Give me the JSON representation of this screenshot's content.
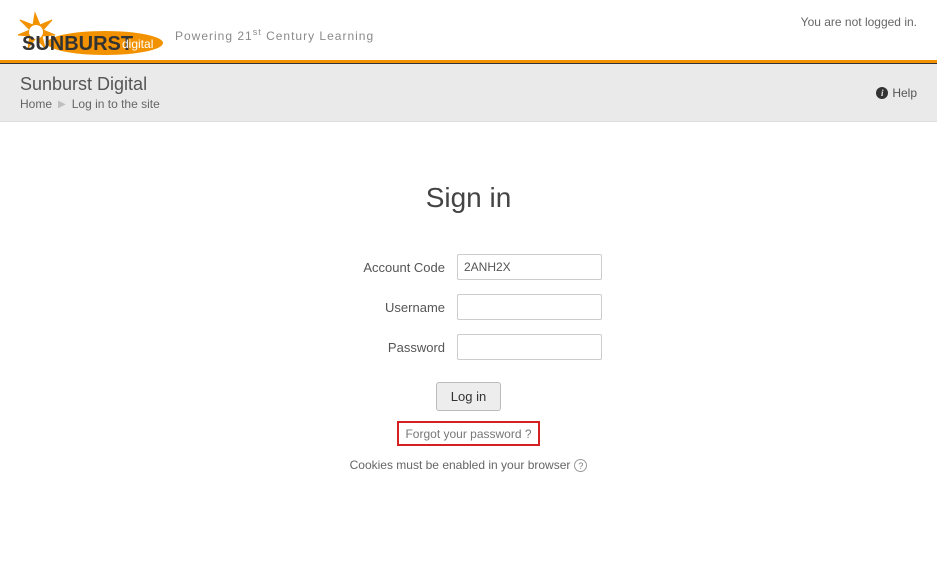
{
  "header": {
    "logo_text_1": "SUNBURST",
    "logo_text_2": "digital",
    "tagline_prefix": "Powering 21",
    "tagline_sup": "st",
    "tagline_suffix": " Century Learning",
    "login_status": "You are not logged in."
  },
  "breadcrumb": {
    "site_name": "Sunburst Digital",
    "home_label": "Home",
    "current_label": "Log in to the site",
    "help_label": "Help"
  },
  "signin": {
    "heading": "Sign in",
    "account_code_label": "Account Code",
    "account_code_value": "2ANH2X",
    "username_label": "Username",
    "username_value": "",
    "password_label": "Password",
    "password_value": "",
    "login_button": "Log in",
    "forgot_link": "Forgot your password ?",
    "cookies_note": "Cookies must be enabled in your browser",
    "help_symbol": "?"
  }
}
